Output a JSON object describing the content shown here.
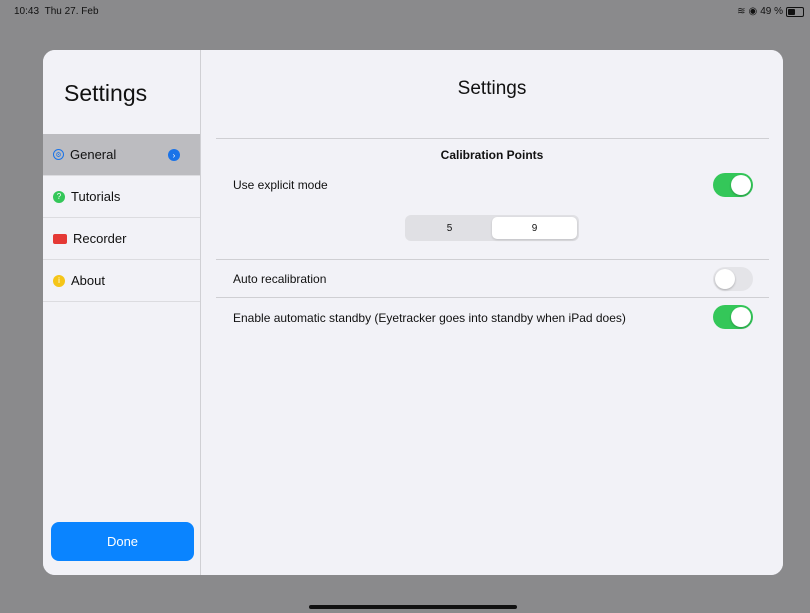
{
  "status": {
    "time": "10:43",
    "date": "Thu 27. Feb",
    "battery": "49 %",
    "battery_level": 0.49
  },
  "sidebar": {
    "title": "Settings",
    "items": [
      {
        "label": "General",
        "icon": "gear-circle-icon",
        "active": true
      },
      {
        "label": "Tutorials",
        "icon": "question-icon"
      },
      {
        "label": "Recorder",
        "icon": "video-camera-icon"
      },
      {
        "label": "About",
        "icon": "info-icon"
      }
    ],
    "done_label": "Done"
  },
  "main": {
    "title": "Settings",
    "section_header": "Calibration Points",
    "explicit_mode_label": "Use explicit mode",
    "explicit_mode_on": true,
    "segments": [
      "5",
      "9"
    ],
    "selected_segment": "9",
    "auto_recal_label": "Auto recalibration",
    "auto_recal_on": false,
    "standby_label": "Enable automatic standby (Eyetracker goes into standby when iPad does)",
    "standby_on": true
  },
  "colors": {
    "accent": "#0a84ff",
    "toggle_on": "#34c759"
  }
}
